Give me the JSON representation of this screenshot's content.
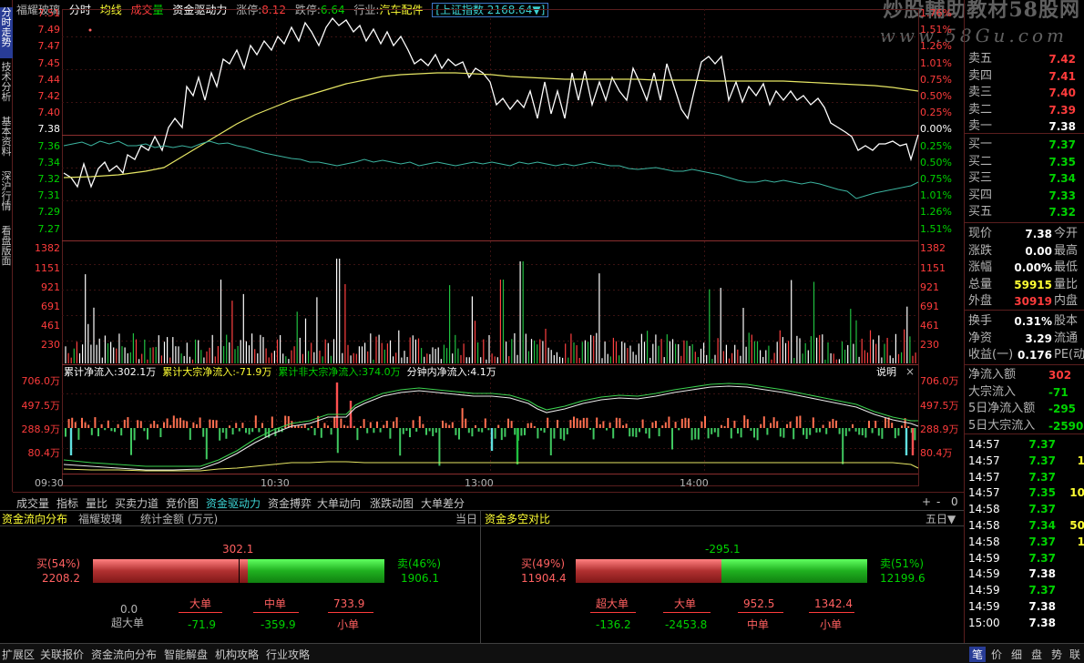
{
  "left_tabs": [
    "分时走势",
    "技术分析",
    "基本资料",
    "深沪行情",
    "看盘版面"
  ],
  "header": {
    "stock_name": "福耀玻璃",
    "mode": "分时",
    "avg": "均线",
    "vol_label_a": "成交",
    "vol_label_b": "量",
    "indicator": "资金驱动力",
    "limit_up_label": "涨停:",
    "limit_up": "8.12",
    "limit_down_label": "跌停:",
    "limit_down": "6.64",
    "industry_label": "行业:",
    "industry": "汽车配件",
    "index_btn": "[上证指数 2168.64▼]"
  },
  "watermark": {
    "line1": "炒股輔助教材58股网",
    "line2": "www.58Gu.com"
  },
  "price_axis": [
    "7.51",
    "7.49",
    "7.47",
    "7.45",
    "7.44",
    "7.42",
    "7.40",
    "7.38",
    "7.36",
    "7.34",
    "7.32",
    "7.31",
    "7.29",
    "7.27"
  ],
  "pct_axis": [
    "1.76%",
    "1.51%",
    "1.26%",
    "1.01%",
    "0.75%",
    "0.50%",
    "0.25%",
    "0.00%",
    "0.25%",
    "0.50%",
    "0.75%",
    "1.01%",
    "1.26%",
    "1.51%"
  ],
  "vol_axis": [
    "1382",
    "1151",
    "921",
    "691",
    "461",
    "230"
  ],
  "flow_legend": {
    "total": "累计净流入:302.1万",
    "block": "累计大宗净流入:-71.9万",
    "nonblock": "累计非大宗净流入:374.0万",
    "minute": "分钟内净流入:4.1万",
    "help": "说明",
    "close": "×"
  },
  "flow_axis": [
    "706.0万",
    "497.5万",
    "288.9万",
    "80.4万"
  ],
  "time_axis": [
    "09:30",
    "10:30",
    "13:00",
    "14:00"
  ],
  "bottom_tabs": [
    "成交量",
    "指标",
    "量比",
    "买卖力道",
    "竞价图",
    "资金驱动力",
    "资金搏弈",
    "大单动向",
    "涨跌动图",
    "大单差分"
  ],
  "zoom_controls": [
    "+",
    "-",
    "0"
  ],
  "panel_left": {
    "title": "资金流向分布",
    "stock": "福耀玻璃",
    "unit": "统计金额 (万元)",
    "period": "当日",
    "net": "302.1",
    "buy_label": "买(54%)",
    "buy_value": "2208.2",
    "sell_label": "卖(46%)",
    "sell_value": "1906.1",
    "xl_value": "0.0",
    "xl_label": "超大单",
    "big_label": "大单",
    "big_value": "-71.9",
    "mid_label": "中单",
    "mid_value": "-359.9",
    "small_value": "733.9",
    "small_label": "小单"
  },
  "panel_right": {
    "title": "资金多空对比",
    "period": "五日▼",
    "net": "-295.1",
    "buy_label": "买(49%)",
    "buy_value": "11904.4",
    "sell_label": "卖(51%)",
    "sell_value": "12199.6",
    "xl_label": "超大单",
    "xl_value": "-136.2",
    "big_label": "大单",
    "big_value": "-2453.8",
    "mid_value": "952.5",
    "mid_label": "中单",
    "small_value": "1342.4",
    "small_label": "小单"
  },
  "status_tabs": [
    "扩展区",
    "关联报价",
    "资金流向分布",
    "智能解盘",
    "机构攻略",
    "行业攻略"
  ],
  "order_book": {
    "asks": [
      {
        "label": "卖五",
        "price": "7.42"
      },
      {
        "label": "卖四",
        "price": "7.41"
      },
      {
        "label": "卖三",
        "price": "7.40"
      },
      {
        "label": "卖二",
        "price": "7.39"
      },
      {
        "label": "卖一",
        "price": "7.38"
      }
    ],
    "bids": [
      {
        "label": "买一",
        "price": "7.37"
      },
      {
        "label": "买二",
        "price": "7.35"
      },
      {
        "label": "买三",
        "price": "7.34"
      },
      {
        "label": "买四",
        "price": "7.33"
      },
      {
        "label": "买五",
        "price": "7.32"
      }
    ]
  },
  "quote": [
    {
      "label": "现价",
      "value": "7.38",
      "label2": "今开"
    },
    {
      "label": "涨跌",
      "value": "0.00",
      "label2": "最高"
    },
    {
      "label": "涨幅",
      "value": "0.00%",
      "label2": "最低"
    },
    {
      "label": "总量",
      "value": "59915",
      "label2": "量比"
    },
    {
      "label": "外盘",
      "value": "30919",
      "label2": "内盘"
    }
  ],
  "stats": [
    {
      "label": "换手",
      "value": "0.31%",
      "label2": "股本"
    },
    {
      "label": "净资",
      "value": "3.29",
      "label2": "流通"
    },
    {
      "label": "收益(一)",
      "value": "0.176",
      "label2": "PE(动"
    }
  ],
  "flows": [
    {
      "label": "净流入额",
      "value": "302"
    },
    {
      "label": "大宗流入",
      "value": "-71"
    },
    {
      "label": "5日净流入额",
      "value": "-295"
    },
    {
      "label": "5日大宗流入",
      "value": "-2590"
    }
  ],
  "ticks": [
    {
      "time": "14:57",
      "price": "7.37",
      "vol": ""
    },
    {
      "time": "14:57",
      "price": "7.37",
      "vol": "1"
    },
    {
      "time": "14:57",
      "price": "7.37",
      "vol": ""
    },
    {
      "time": "14:57",
      "price": "7.35",
      "vol": "10"
    },
    {
      "time": "14:58",
      "price": "7.37",
      "vol": ""
    },
    {
      "time": "14:58",
      "price": "7.34",
      "vol": "50"
    },
    {
      "time": "14:58",
      "price": "7.37",
      "vol": "1"
    },
    {
      "time": "14:59",
      "price": "7.37",
      "vol": ""
    },
    {
      "time": "14:59",
      "price": "7.38",
      "vol": ""
    },
    {
      "time": "14:59",
      "price": "7.37",
      "vol": ""
    },
    {
      "time": "14:59",
      "price": "7.38",
      "vol": ""
    },
    {
      "time": "15:00",
      "price": "7.38",
      "vol": ""
    }
  ],
  "side_bottom_tabs": [
    "笔",
    "价",
    "细",
    "盘",
    "势",
    "联"
  ]
}
